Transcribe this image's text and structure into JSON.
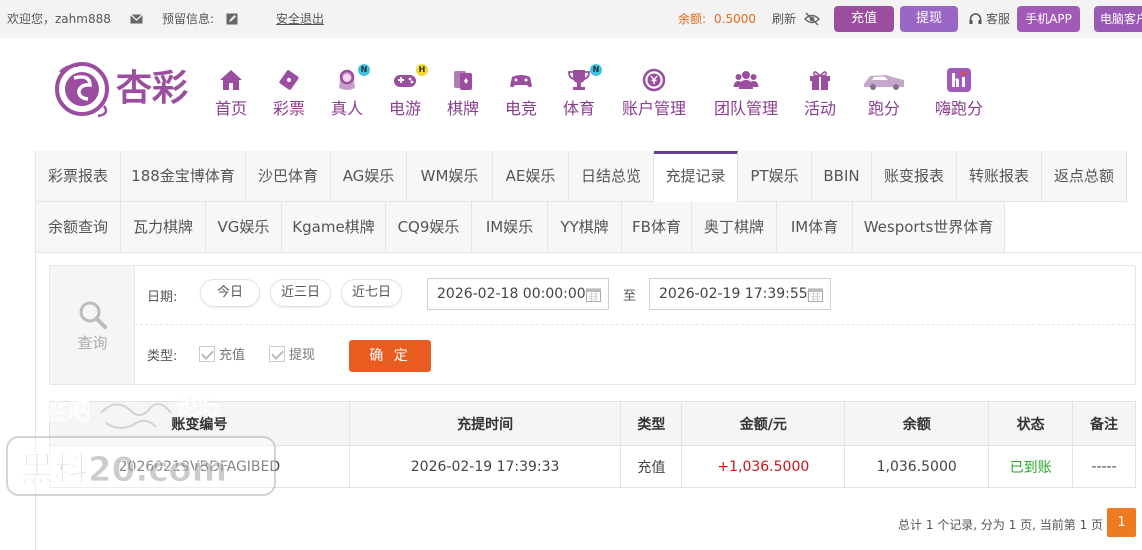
{
  "topbar": {
    "welcome": "欢迎您，zahm888",
    "notice_label": "预留信息:",
    "logout": "安全退出",
    "balance_label": "余额:",
    "balance_value": "0.5000",
    "refresh": "刷新",
    "recharge": "充值",
    "withdraw": "提现",
    "service": "客服",
    "mobile_app": "手机APP",
    "pc_client": "电脑客户"
  },
  "logo": {
    "text": "杏彩"
  },
  "nav": [
    {
      "label": "首页",
      "icon": "home-icon",
      "badge": ""
    },
    {
      "label": "彩票",
      "icon": "lottery-ticket-icon",
      "badge": ""
    },
    {
      "label": "真人",
      "icon": "live-dealer-icon",
      "badge": "N"
    },
    {
      "label": "电游",
      "icon": "gamepad-icon",
      "badge": "H"
    },
    {
      "label": "棋牌",
      "icon": "cards-icon",
      "badge": ""
    },
    {
      "label": "电竞",
      "icon": "esports-controller-icon",
      "badge": ""
    },
    {
      "label": "体育",
      "icon": "trophy-icon",
      "badge": "N"
    },
    {
      "label": "账户管理",
      "icon": "yen-coin-icon",
      "badge": ""
    },
    {
      "label": "团队管理",
      "icon": "team-icon",
      "badge": ""
    },
    {
      "label": "活动",
      "icon": "gift-icon",
      "badge": ""
    },
    {
      "label": "跑分",
      "icon": "race-car-icon",
      "badge": ""
    },
    {
      "label": "嗨跑分",
      "icon": "hi-logo-icon",
      "badge": ""
    }
  ],
  "tabs_row1": [
    "彩票报表",
    "188金宝博体育",
    "沙巴体育",
    "AG娱乐",
    "WM娱乐",
    "AE娱乐",
    "日结总览",
    "充提记录",
    "PT娱乐",
    "BBIN",
    "账变报表",
    "转账报表",
    "返点总额"
  ],
  "tabs_row2": [
    "余额查询",
    "瓦力棋牌",
    "VG娱乐",
    "Kgame棋牌",
    "CQ9娱乐",
    "IM娱乐",
    "YY棋牌",
    "FB体育",
    "奥丁棋牌",
    "IM体育",
    "Wesports世界体育"
  ],
  "active_tab": "充提记录",
  "query": {
    "side_label": "查询",
    "date_label": "日期:",
    "quick_ranges": [
      "今日",
      "近三日",
      "近七日"
    ],
    "start_date": "2026-02-18 00:00:00",
    "to": "至",
    "end_date": "2026-02-19 17:39:55",
    "type_label": "类型:",
    "type_options": [
      "充值",
      "提现"
    ],
    "confirm": "确 定"
  },
  "table": {
    "headers": [
      "账变编号",
      "充提时间",
      "类型",
      "金额/元",
      "余额",
      "状态",
      "备注"
    ],
    "rows": [
      [
        "20260219VBDFAGIBED",
        "2026-02-19 17:39:33",
        "充值",
        "+1,036.5000",
        "1,036.5000",
        "已到账",
        "-----"
      ]
    ]
  },
  "pager": {
    "summary": "总计 1 个记录, 分为 1 页, 当前第 1 页",
    "current": "1"
  },
  "watermark": {
    "line1": "杏吧",
    "line2": "论坛",
    "line3": "黑料20.com"
  },
  "colors": {
    "brand_purple": "#8a3e8f",
    "accent_orange": "#e85d1f",
    "amount_red": "#c8161d",
    "status_green": "#2aa52a"
  }
}
